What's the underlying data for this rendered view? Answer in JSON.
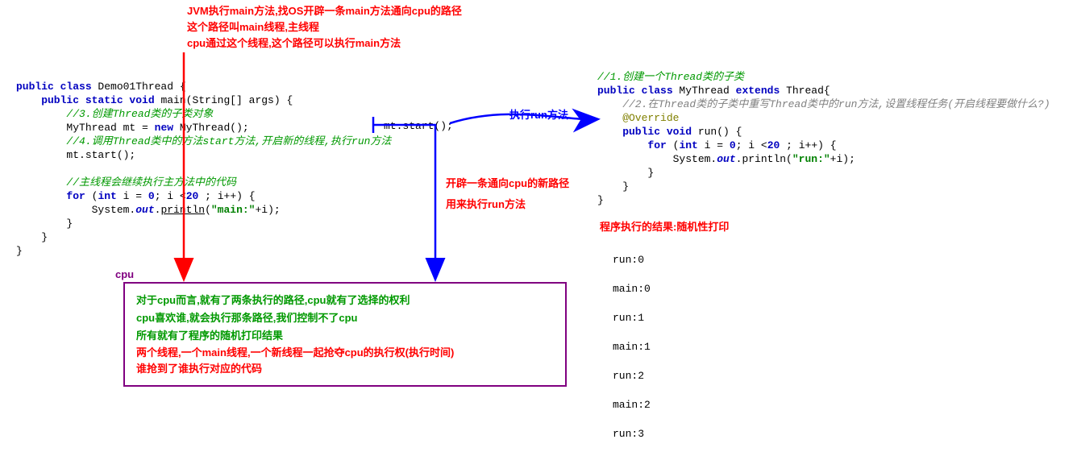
{
  "top_notes": {
    "l1": "JVM执行main方法,找OS开辟一条main方法通向cpu的路径",
    "l2": "这个路径叫main线程,主线程",
    "l3": "cpu通过这个线程,这个路径可以执行main方法"
  },
  "left_code": {
    "l1a": "public class ",
    "l1b": "Demo01Thread {",
    "l2a": "    public static void ",
    "l2b": "main(String[] args) {",
    "c3": "        //3.创建Thread类的子类对象",
    "l4a": "        MyThread mt = ",
    "l4b": "new ",
    "l4c": "MyThread();",
    "c5": "        //4.调用Thread类中的方法start方法,开启新的线程,执行run方法",
    "l6": "        mt.start();",
    "c7": "        //主线程会继续执行主方法中的代码",
    "l8a": "        for ",
    "l8b": "(",
    "l8c": "int ",
    "l8d": "i = ",
    "l8e": "0",
    "l8f": "; i <",
    "l8g": "20 ",
    "l8h": "; i++) {",
    "l9a": "            System.",
    "l9b": "out",
    "l9c": ".",
    "l9d": "println",
    "l9e": "(",
    "l9f": "\"main:\"",
    "l9g": "+i);",
    "l10": "        }",
    "l11": "    }",
    "l12": "}"
  },
  "mid_code": {
    "call": "mt.start();"
  },
  "mid_notes": {
    "run": "执行run方法",
    "n1": "开辟一条通向cpu的新路径",
    "n2": "用来执行run方法"
  },
  "right_code": {
    "c1": "//1.创建一个Thread类的子类",
    "l2a": "public class ",
    "l2b": "MyThread ",
    "l2c": "extends ",
    "l2d": "Thread{",
    "c3": "    //2.在Thread类的子类中重写Thread类中的run方法,设置线程任务(开启线程要做什么?)",
    "ann": "    @Override",
    "l5a": "    public void ",
    "l5b": "run() {",
    "l6a": "        for ",
    "l6b": "(",
    "l6c": "int ",
    "l6d": "i = ",
    "l6e": "0",
    "l6f": "; i <",
    "l6g": "20 ",
    "l6h": "; i++) {",
    "l7a": "            System.",
    "l7b": "out",
    "l7c": ".println(",
    "l7d": "\"run:\"",
    "l7e": "+i);",
    "l8": "        }",
    "l9": "    }",
    "l10": "}"
  },
  "result_title": "程序执行的结果:随机性打印",
  "result_lines": [
    "run:0",
    "main:0",
    "run:1",
    "main:1",
    "run:2",
    "main:2",
    "run:3"
  ],
  "cpu_label": "cpu",
  "cpu_box": {
    "g1": "对于cpu而言,就有了两条执行的路径,cpu就有了选择的权利",
    "g2": "cpu喜欢谁,就会执行那条路径,我们控制不了cpu",
    "g3": "所有就有了程序的随机打印结果",
    "r1": "两个线程,一个main线程,一个新线程一起抢夺cpu的执行权(执行时间)",
    "r2": "谁抢到了谁执行对应的代码"
  }
}
